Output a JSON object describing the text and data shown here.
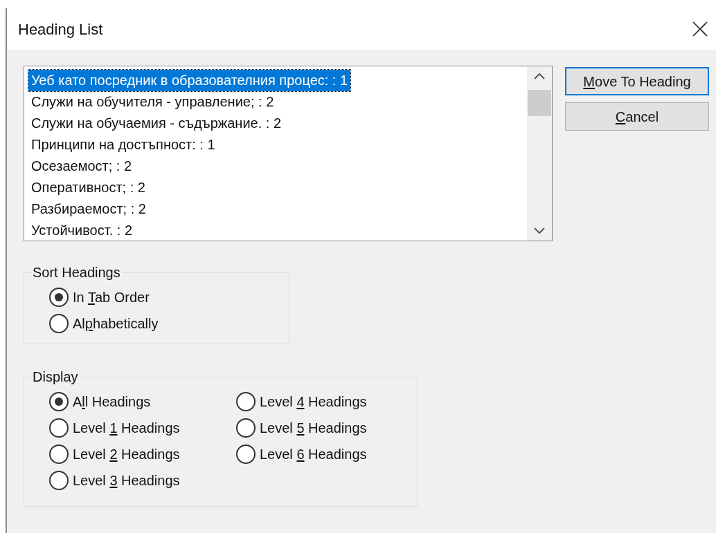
{
  "window": {
    "title": "Heading List"
  },
  "headings": [
    {
      "text": "Уеб като посредник в образователния процес: : 1",
      "selected": true
    },
    {
      "text": "Служи на обучителя - управление; : 2",
      "selected": false
    },
    {
      "text": "Служи на обучаемия - съдържание. : 2",
      "selected": false
    },
    {
      "text": "Принципи на достъпност: : 1",
      "selected": false
    },
    {
      "text": "Осезаемост; : 2",
      "selected": false
    },
    {
      "text": "Оперативност; : 2",
      "selected": false
    },
    {
      "text": "Разбираемост; : 2",
      "selected": false
    },
    {
      "text": "Устойчивост. : 2",
      "selected": false
    }
  ],
  "buttons": [
    {
      "accel": "M",
      "after": "ove To Heading",
      "default": true
    },
    {
      "accel": "C",
      "after": "ancel",
      "default": false
    }
  ],
  "sort": {
    "title": "Sort Headings",
    "options": [
      {
        "before": "In ",
        "accel": "T",
        "after": "ab Order",
        "selected": true
      },
      {
        "before": "Al",
        "accel": "p",
        "after": "habetically",
        "selected": false
      }
    ]
  },
  "display": {
    "title": "Display",
    "options": [
      {
        "before": "A",
        "accel": "l",
        "after": "l Headings",
        "selected": true
      },
      {
        "before": "Level ",
        "accel": "1",
        "after": " Headings",
        "selected": false
      },
      {
        "before": "Level ",
        "accel": "2",
        "after": " Headings",
        "selected": false
      },
      {
        "before": "Level ",
        "accel": "3",
        "after": " Headings",
        "selected": false
      },
      {
        "before": "Level ",
        "accel": "4",
        "after": " Headings",
        "selected": false
      },
      {
        "before": "Level ",
        "accel": "5",
        "after": " Headings",
        "selected": false
      },
      {
        "before": "Level ",
        "accel": "6",
        "after": " Headings",
        "selected": false
      }
    ]
  }
}
